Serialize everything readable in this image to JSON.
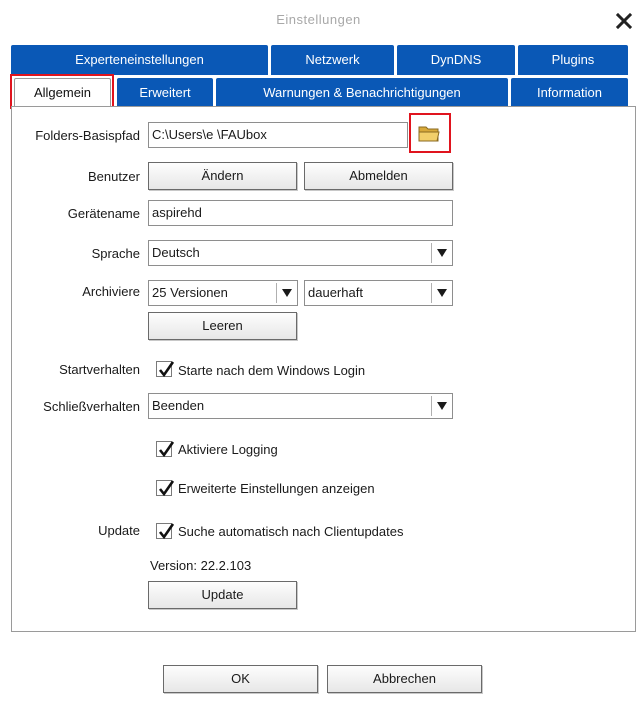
{
  "window": {
    "title": "Einstellungen"
  },
  "tabs_top": [
    {
      "label": "Experteneinstellungen"
    },
    {
      "label": "Netzwerk"
    },
    {
      "label": "DynDNS"
    },
    {
      "label": "Plugins"
    }
  ],
  "tabs_bottom": [
    {
      "label": "Allgemein",
      "active": true
    },
    {
      "label": "Erweitert"
    },
    {
      "label": "Warnungen & Benachrichtigungen"
    },
    {
      "label": "Information"
    }
  ],
  "form": {
    "folders": {
      "label": "Folders-Basispfad",
      "value": "C:\\Users\\e          \\FAUbox",
      "icon": "folder-icon"
    },
    "user": {
      "label": "Benutzer",
      "change_button": "Ändern",
      "logout_button": "Abmelden"
    },
    "device": {
      "label": "Gerätename",
      "value": "aspirehd"
    },
    "language": {
      "label": "Sprache",
      "value": "Deutsch"
    },
    "archive": {
      "label": "Archiviere",
      "versions": "25 Versionen",
      "duration": "dauerhaft",
      "clear_button": "Leeren"
    },
    "startup": {
      "label": "Startverhalten",
      "checkbox_label": "Starte nach dem Windows Login",
      "checked": true
    },
    "close": {
      "label": "Schließverhalten",
      "value": "Beenden"
    },
    "logging": {
      "checkbox_label": "Aktiviere Logging",
      "checked": true
    },
    "advanced": {
      "checkbox_label": "Erweiterte Einstellungen anzeigen",
      "checked": true
    },
    "update": {
      "label": "Update",
      "checkbox_label": "Suche automatisch nach Clientupdates",
      "checked": true,
      "version": "Version: 22.2.103",
      "button": "Update"
    }
  },
  "footer": {
    "ok": "OK",
    "cancel": "Abbrechen"
  },
  "colors": {
    "tab_blue": "#0a58b6",
    "highlight_red": "#e0141e"
  }
}
